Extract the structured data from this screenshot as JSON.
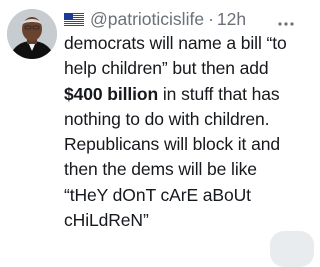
{
  "tweet": {
    "username": "@patrioticislife",
    "separator": "·",
    "time": "12h",
    "lines": [
      {
        "text": "democrats will name a bill “to"
      },
      {
        "text": "help children” but then add"
      },
      {
        "bold": "$400 billion",
        "rest": " in stuff that has"
      },
      {
        "text": "nothing to do with children."
      },
      {
        "text": "Republicans will block it and"
      },
      {
        "text": "then the dems will be like"
      },
      {
        "text": "“tHeY dOnT cArE aBoUt"
      },
      {
        "text": "cHiLdReN”"
      }
    ]
  },
  "icons": {
    "flag": "us-flag-icon",
    "more": "more-options-icon",
    "avatar": "avatar"
  },
  "colors": {
    "text": "#15181c",
    "secondary": "#6b7178",
    "background": "#ffffff"
  }
}
